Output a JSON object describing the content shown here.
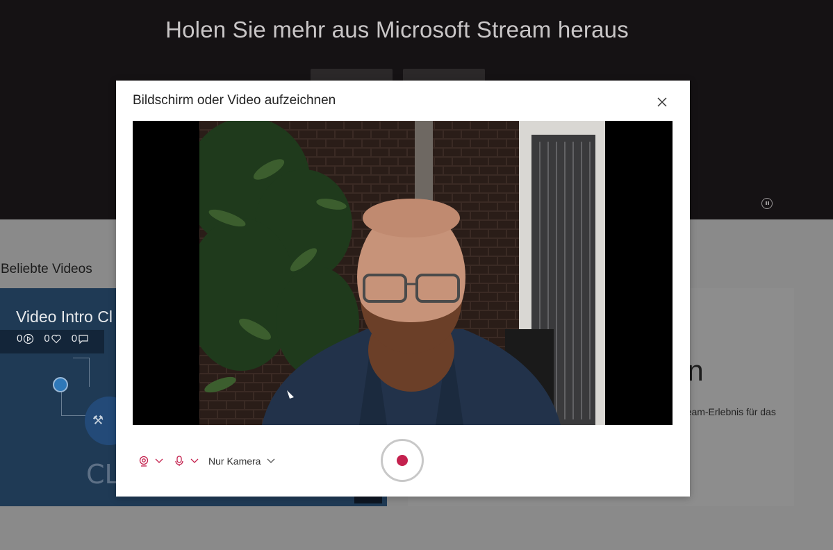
{
  "background": {
    "hero_title": "Holen Sie mehr aus Microsoft Stream heraus",
    "section_title": "Beliebte Videos",
    "video_card": {
      "title": "Video Intro Cl",
      "views": "0",
      "likes": "0",
      "comments": "0",
      "overlay_text": "CL"
    },
    "promo": {
      "heading": "en",
      "text": "ream-Erlebnis für das"
    }
  },
  "dialog": {
    "title": "Bildschirm oder Video aufzeichnen",
    "close_icon": "close-icon",
    "camera_select_icon": "webcam-icon",
    "microphone_select_icon": "microphone-icon",
    "mode_label": "Nur Kamera",
    "record_icon": "record-icon"
  },
  "colors": {
    "accent": "#c4214e",
    "hero_bg": "#151214",
    "overlay": "#8a8a8a"
  }
}
